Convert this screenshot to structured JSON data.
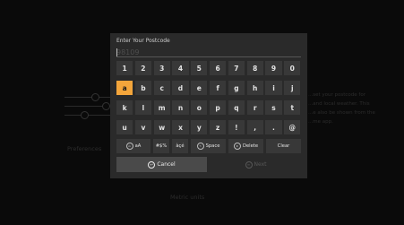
{
  "background": {
    "preferences_label": "Preferences",
    "metric_label": "Metric units",
    "description_text": "...set your postcode for\n...and local weather. This\n...e also be shown from the\n...me app."
  },
  "dialog": {
    "title": "Enter Your Postcode",
    "input_placeholder": "98109",
    "input_value": ""
  },
  "keyboard": {
    "rows": [
      [
        "1",
        "2",
        "3",
        "4",
        "5",
        "6",
        "7",
        "8",
        "9",
        "0"
      ],
      [
        "a",
        "b",
        "c",
        "d",
        "e",
        "f",
        "g",
        "h",
        "i",
        "j"
      ],
      [
        "k",
        "l",
        "m",
        "n",
        "o",
        "p",
        "q",
        "r",
        "s",
        "t"
      ],
      [
        "u",
        "v",
        "w",
        "x",
        "y",
        "z",
        "!",
        ",",
        ".",
        "@"
      ]
    ],
    "selected_key": "a",
    "bottom_row": {
      "shift_icon": "shift-circle-icon",
      "shift_label": "aA",
      "symbols_label": "#$%",
      "accents_label": "àçé",
      "space_label": "Space",
      "space_icon": "rewind-icon",
      "delete_label": "Delete",
      "delete_icon": "play-pause-icon",
      "clear_label": "Clear"
    }
  },
  "buttons": {
    "cancel_label": "Cancel",
    "cancel_icon": "back-circle-icon",
    "next_label": "Next",
    "next_icon": "menu-circle-icon"
  },
  "colors": {
    "highlight": "#f3a53b",
    "dialog_bg": "#2a2a2a",
    "key_bg": "#383838"
  }
}
